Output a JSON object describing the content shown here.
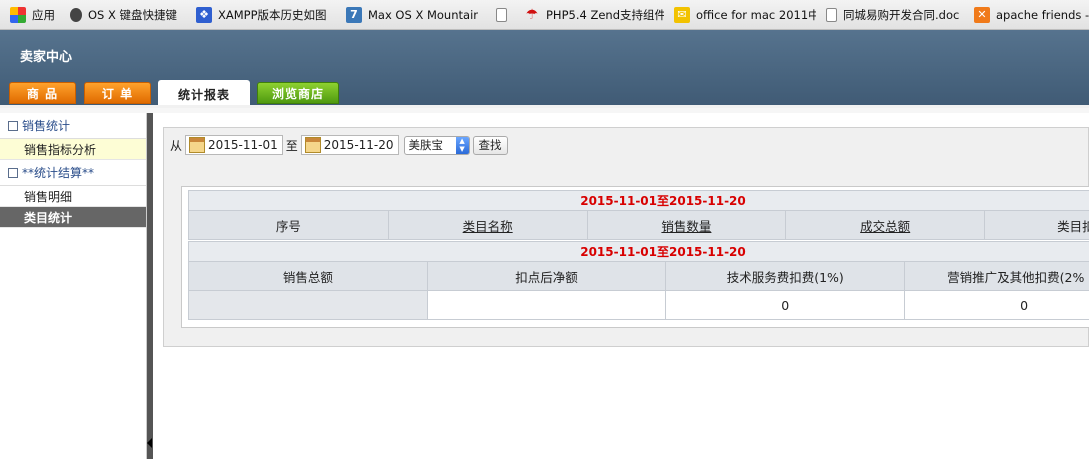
{
  "bookmarks": [
    {
      "icon": "apps-grid-icon",
      "label": "应用"
    },
    {
      "icon": "apple-icon",
      "label": "OS X 键盘快捷键"
    },
    {
      "icon": "paw-icon",
      "label": "XAMPP版本历史如图"
    },
    {
      "icon": "number-7-icon",
      "label": "Max OS X Mountain"
    },
    {
      "icon": "page-icon",
      "label": ""
    },
    {
      "icon": "umbrella-icon",
      "label": "PHP5.4 Zend支持组件"
    },
    {
      "icon": "mail-icon",
      "label": "office for mac 2011中"
    },
    {
      "icon": "document-icon",
      "label": "同城易购开发合同.doc"
    },
    {
      "icon": "xampp-icon",
      "label": "apache friends -"
    }
  ],
  "header": {
    "title": "卖家中心",
    "tabs": [
      "商  品",
      "订  单",
      "统计报表",
      "浏览商店"
    ]
  },
  "sidebar": {
    "groups": [
      {
        "label": "销售统计",
        "items": [
          "销售指标分析"
        ]
      },
      {
        "label": "**统计结算**",
        "items": [
          "销售明细",
          "类目统计"
        ]
      }
    ]
  },
  "search": {
    "from_label": "从",
    "start_date": "2015-11-01",
    "to_label": "至",
    "end_date": "2015-11-20",
    "category": "美肤宝",
    "button": "查找"
  },
  "report": {
    "range_title": "2015-11-01至2015-11-20",
    "table1_headers": [
      "序号",
      "类目名称",
      "销售数量",
      "成交总额",
      "类目扣"
    ],
    "table2_title": "2015-11-01至2015-11-20",
    "table2_headers": [
      "销售总额",
      "扣点后净额",
      "技术服务费扣费(1%)",
      "营销推广及其他扣费(2%"
    ],
    "table2_values": [
      "",
      "",
      "0",
      "0"
    ]
  },
  "colors": {
    "header_bg": "#4b6882",
    "tab_orange": "#f08a10",
    "tab_green": "#6fb820",
    "date_red": "#d80000"
  }
}
